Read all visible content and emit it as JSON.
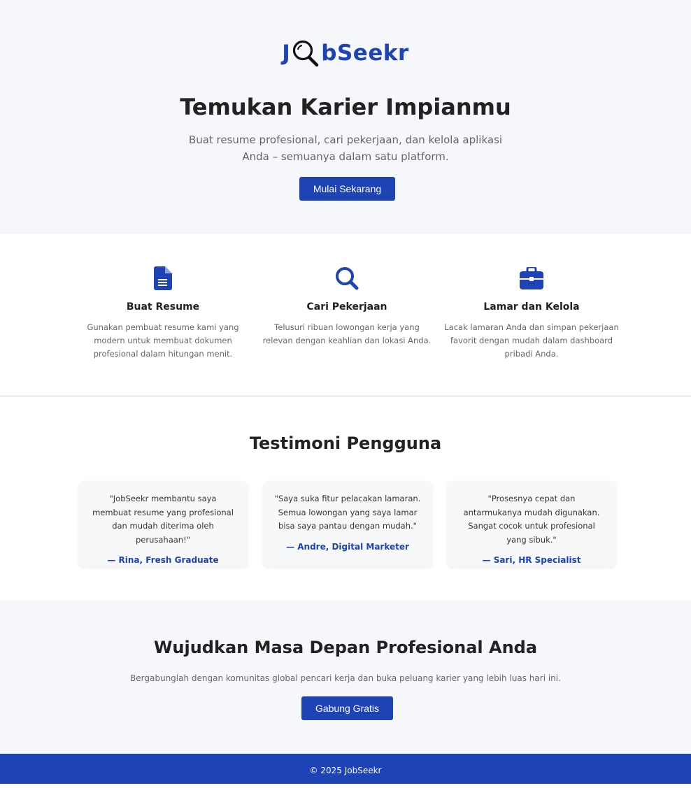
{
  "brand": {
    "logo_prefix": "J",
    "logo_suffix": "bSeekr",
    "logo_icon": "magnifier-icon",
    "primary_color": "#1d43b5"
  },
  "hero": {
    "title": "Temukan Karier Impianmu",
    "subtitle": "Buat resume profesional, cari pekerjaan, dan kelola aplikasi Anda – semuanya dalam satu platform.",
    "cta_label": "Mulai Sekarang"
  },
  "features": [
    {
      "icon": "document-icon",
      "title": "Buat Resume",
      "description": "Gunakan pembuat resume kami yang modern untuk membuat dokumen profesional dalam hitungan menit."
    },
    {
      "icon": "search-icon",
      "title": "Cari Pekerjaan",
      "description": "Telusuri ribuan lowongan kerja yang relevan dengan keahlian dan lokasi Anda."
    },
    {
      "icon": "briefcase-icon",
      "title": "Lamar dan Kelola",
      "description": "Lacak lamaran Anda dan simpan pekerjaan favorit dengan mudah dalam dashboard pribadi Anda."
    }
  ],
  "testimonials": {
    "title": "Testimoni Pengguna",
    "items": [
      {
        "quote": "\"JobSeekr membantu saya membuat resume yang profesional dan mudah diterima oleh perusahaan!\"",
        "author": "— Rina, Fresh Graduate"
      },
      {
        "quote": "\"Saya suka fitur pelacakan lamaran. Semua lowongan yang saya lamar bisa saya pantau dengan mudah.\"",
        "author": "— Andre, Digital Marketer"
      },
      {
        "quote": "\"Prosesnya cepat dan antarmukanya mudah digunakan. Sangat cocok untuk profesional yang sibuk.\"",
        "author": "— Sari, HR Specialist"
      }
    ]
  },
  "cta": {
    "title": "Wujudkan Masa Depan Profesional Anda",
    "subtitle": "Bergabunglah dengan komunitas global pencari kerja dan buka peluang karier yang lebih luas hari ini.",
    "button_label": "Gabung Gratis"
  },
  "footer": {
    "text": "© 2025 JobSeekr"
  }
}
